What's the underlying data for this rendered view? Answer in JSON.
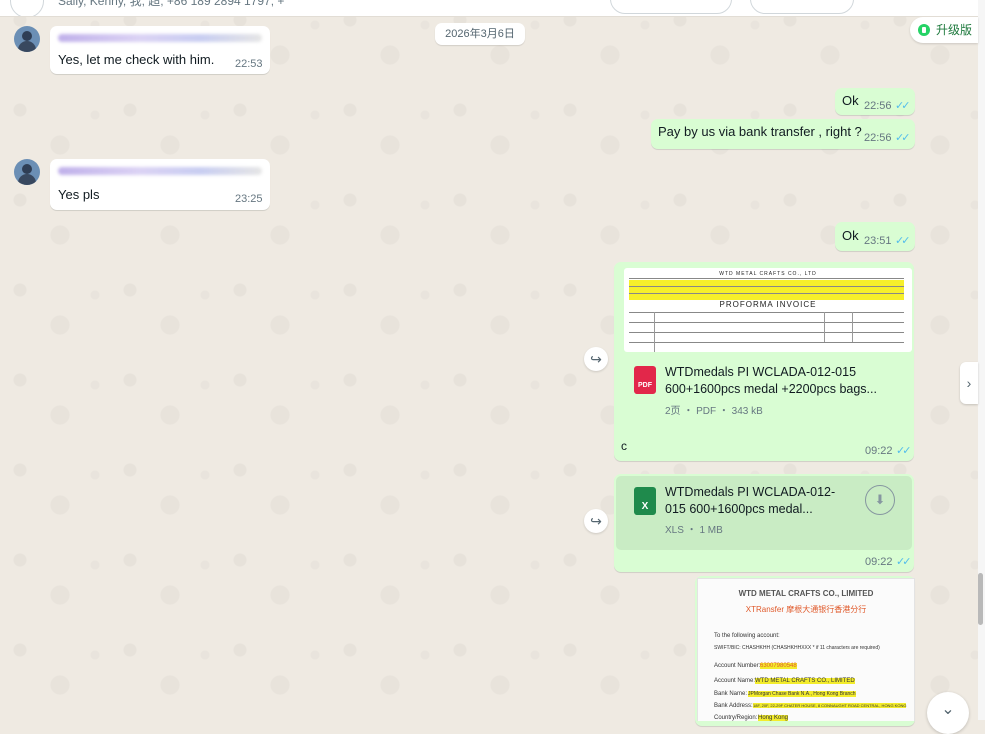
{
  "header": {
    "subtitle": "Sally, Kenny, 我, 超, +86 189 2894 1797, +"
  },
  "date_divider": "2026年3月6日",
  "upgrade": {
    "label": "升级版"
  },
  "messages": [
    {
      "text": "Yes, let me check with him.",
      "time": "22:53"
    },
    {
      "text": "Ok",
      "time": "22:56"
    },
    {
      "text": "Pay by us via bank transfer , right ?",
      "time": "22:56"
    },
    {
      "text": "Yes pls",
      "time": "23:25"
    },
    {
      "text": "Ok",
      "time": "23:51"
    }
  ],
  "tick_symbol": "✓✓",
  "forward_symbol": "↪",
  "pdf": {
    "preview_title": "WTD METAL CRAFTS CO., LTD",
    "preview_heading": "PROFORMA INVOICE",
    "icon_label": "PDF",
    "name": "WTDmedals PI  WCLADA-012-015 600+1600pcs medal +2200pcs bags...",
    "meta": "2页 ・ PDF ・ 343 kB",
    "caption": "c",
    "time": "09:22"
  },
  "xls": {
    "icon_label": "X",
    "name": "WTDmedals PI  WCLADA-012-015 600+1600pcs medal...",
    "meta": "XLS ・ 1 MB",
    "time": "09:22",
    "download_symbol": "⬇"
  },
  "receipt": {
    "company": "WTD METAL CRAFTS CO., LIMITED",
    "bank_brand": "XTRansfer 摩根大通银行香港分行",
    "to": "To the following account:",
    "swift": "SWIFT/BIC: CHASHKHH (CHASHKHHXXX * if 11 characters are required)",
    "account_number_label": "Account Number:",
    "account_number_value": "63007980548",
    "account_name_label": "Account Name:",
    "account_name_value": "WTD METAL CRAFTS CO., LIMITED",
    "bank_name_label": "Bank Name:",
    "bank_name_value": "JPMorgan Chase Bank N.A., Hong Kong Branch",
    "bank_address_label": "Bank Address:",
    "bank_address_value": "18F, 20F, 22-29F CHATER HOUSE, 8 CONNAUGHT ROAD CENTRAL, HONG KONG",
    "country_label": "Country/Region:",
    "country_value": "Hong Kong"
  },
  "nav": {
    "side_arrow": "›",
    "scroll_down": "⌄"
  }
}
